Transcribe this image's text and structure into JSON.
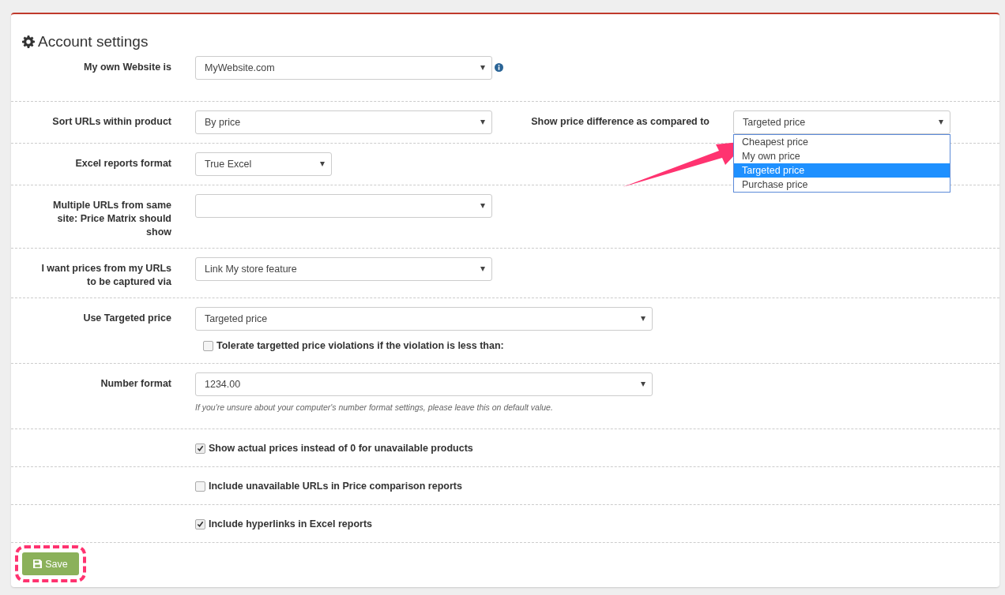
{
  "title": "Account settings",
  "rows": [
    {
      "kind": "select",
      "label": "My own Website is",
      "value": "MyWebsite.com",
      "info": true
    },
    {
      "kind": "select",
      "label": "Sort URLs within product",
      "value": "By price",
      "secondary": {
        "label": "Show price difference as compared to",
        "value": "Targeted price",
        "expanded": true,
        "pointed_at": true,
        "options": [
          {
            "label": "Cheapest price",
            "selected": false
          },
          {
            "label": "My own price",
            "selected": false
          },
          {
            "label": "Targeted price",
            "selected": true
          },
          {
            "label": "Purchase price",
            "selected": false
          }
        ]
      }
    },
    {
      "kind": "select",
      "label": "Excel reports format",
      "value": "True Excel"
    },
    {
      "kind": "select",
      "label": "Multiple URLs from same site: Price Matrix should show",
      "value": ""
    },
    {
      "kind": "select",
      "label": "I want prices from my URLs to be captured via",
      "value": "Link My store feature"
    },
    {
      "kind": "select",
      "label": "Use Targeted price",
      "value": "Targeted price",
      "checkbox": {
        "label": "Tolerate targetted price violations if the violation is less than:",
        "checked": false
      }
    },
    {
      "kind": "select",
      "label": "Number format",
      "value": "1234.00",
      "help": "If you're unsure about your computer's number format settings, please leave this on default value."
    },
    {
      "kind": "checkbox",
      "label": "Show actual prices instead of 0 for unavailable products",
      "checked": true
    },
    {
      "kind": "checkbox",
      "label": "Include unavailable URLs in Price comparison reports",
      "checked": false
    },
    {
      "kind": "checkbox",
      "label": "Include hyperlinks in Excel reports",
      "checked": true
    }
  ],
  "save_button": {
    "label": "Save",
    "highlighted": true
  }
}
